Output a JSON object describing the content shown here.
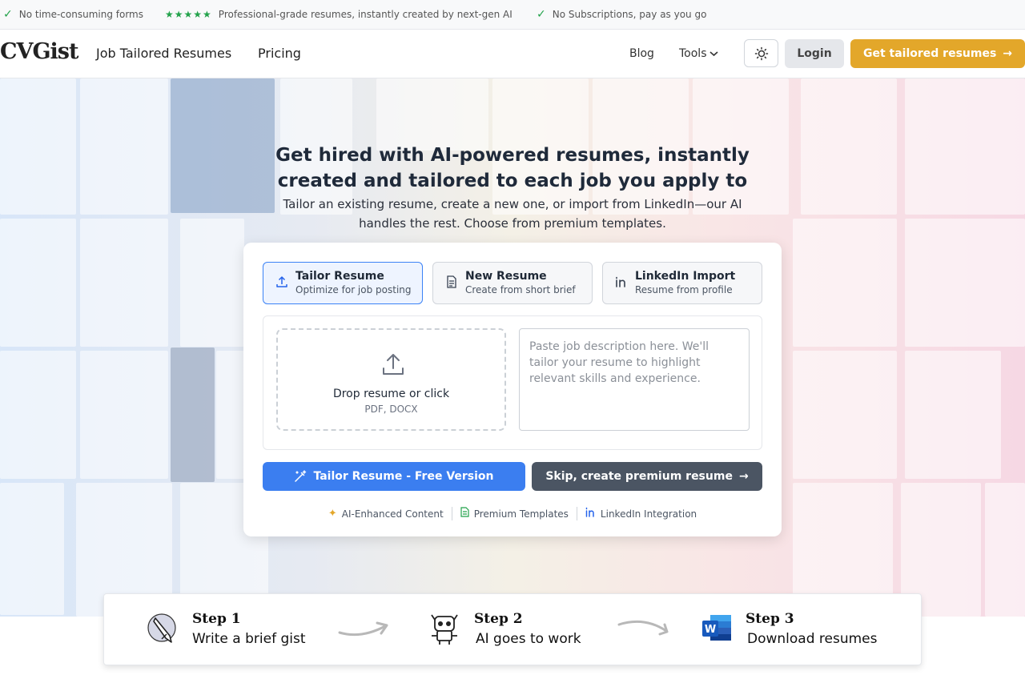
{
  "topbar": {
    "perk1": "No time-consuming forms",
    "stars": "★★★★★",
    "perk2": "Professional-grade resumes, instantly created by next-gen AI",
    "perk3": "No Subscriptions, pay as you go"
  },
  "header": {
    "logo": "CVGist",
    "nav_tailored": "Job Tailored Resumes",
    "nav_pricing": "Pricing",
    "nav_blog": "Blog",
    "nav_tools": "Tools",
    "login": "Login",
    "cta": "Get tailored resumes",
    "cta_arrow": "→"
  },
  "hero": {
    "title": "Get hired with AI-powered resumes, instantly created and tailored to each job you apply to",
    "subtitle": "Tailor an existing resume, create a new one, or import from LinkedIn—our AI handles the rest. Choose from premium templates."
  },
  "tabs": [
    {
      "title": "Tailor Resume",
      "subtitle": "Optimize for job posting",
      "icon": "upload-icon",
      "active": true
    },
    {
      "title": "New Resume",
      "subtitle": "Create from short brief",
      "icon": "document-icon",
      "active": false
    },
    {
      "title": "LinkedIn Import",
      "subtitle": "Resume from profile",
      "icon": "linkedin-icon",
      "active": false
    }
  ],
  "upload": {
    "title": "Drop resume or click",
    "formats": "PDF, DOCX"
  },
  "job_description": {
    "placeholder": "Paste job description here. We'll tailor your resume to highlight relevant skills and experience."
  },
  "actions": {
    "tailor": "Tailor Resume - Free Version",
    "skip": "Skip, create premium resume",
    "skip_arrow": "→"
  },
  "features": [
    {
      "label": "AI-Enhanced Content",
      "icon": "sparkle-icon"
    },
    {
      "label": "Premium Templates",
      "icon": "document-icon"
    },
    {
      "label": "LinkedIn Integration",
      "icon": "linkedin-icon"
    }
  ],
  "steps": [
    {
      "title": "Step 1",
      "desc": "Write a brief gist",
      "icon": "pen-icon"
    },
    {
      "title": "Step 2",
      "desc": "AI goes to work",
      "icon": "robot-icon"
    },
    {
      "title": "Step 3",
      "desc": "Download resumes",
      "icon": "word-icon"
    }
  ],
  "colors": {
    "accent_gold": "#e3a72a",
    "primary_blue": "#3b7ef0",
    "dark_button": "#4b5563",
    "check_green": "#22a24a"
  }
}
